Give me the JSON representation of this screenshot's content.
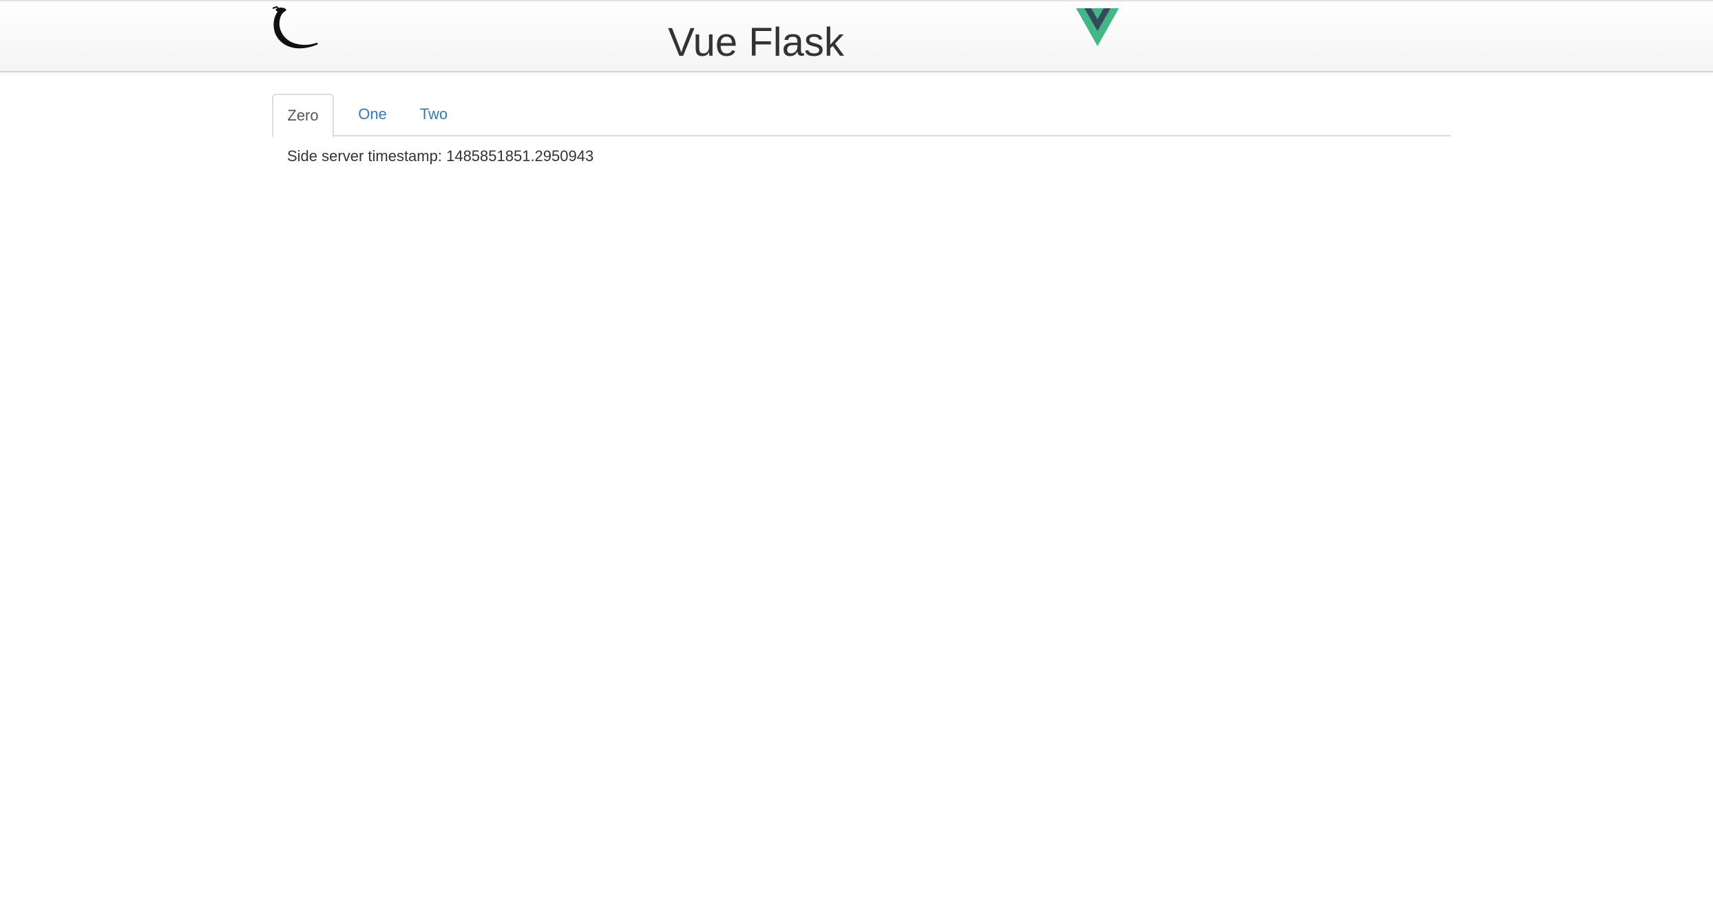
{
  "header": {
    "title": "Vue Flask",
    "left_logo": "flask-logo",
    "right_logo": "vue-logo"
  },
  "tabs": [
    {
      "label": "Zero",
      "active": true
    },
    {
      "label": "One",
      "active": false
    },
    {
      "label": "Two",
      "active": false
    }
  ],
  "content": {
    "timestamp_label": "Side server timestamp:",
    "timestamp_value": "1485851851.2950943"
  },
  "colors": {
    "link": "#337ab7",
    "text": "#333333",
    "vue_green": "#41b883",
    "vue_dark": "#35495e"
  }
}
